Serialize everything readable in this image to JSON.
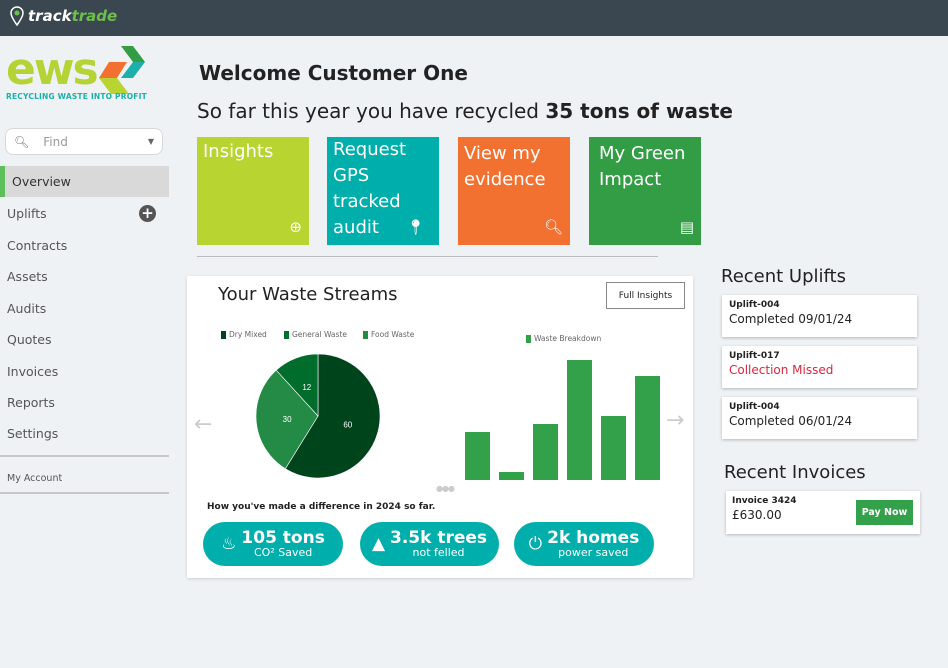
{
  "app": {
    "brand_a": "track",
    "brand_b": "trade"
  },
  "logo": {
    "word": "ews",
    "tagline": "RECYCLING WASTE INTO PROFIT"
  },
  "search": {
    "placeholder": "Find"
  },
  "sidebar": {
    "items": [
      {
        "label": "Overview",
        "active": true
      },
      {
        "label": "Uplifts"
      },
      {
        "label": "Contracts"
      },
      {
        "label": "Assets"
      },
      {
        "label": "Audits"
      },
      {
        "label": "Quotes"
      },
      {
        "label": "Invoices"
      },
      {
        "label": "Reports"
      },
      {
        "label": "Settings"
      }
    ],
    "account": "My Account"
  },
  "header": {
    "welcome": "Welcome Customer One",
    "recycled_prefix": "So far this year you have recycled ",
    "recycled_amount": "35 tons of waste"
  },
  "tiles": [
    {
      "label": "Insights",
      "color": "#b8d430",
      "icon": "plus-circle-icon"
    },
    {
      "label": "Request GPS tracked audit",
      "color": "#00aeab",
      "icon": "map-pin-icon"
    },
    {
      "label": "View my evidence",
      "color": "#f37130",
      "icon": "search-icon"
    },
    {
      "label": "My Green Impact",
      "color": "#339d46",
      "icon": "receipt-icon"
    }
  ],
  "waste": {
    "title": "Your Waste Streams",
    "full_insights": "Full Insights",
    "difference": "How you've made a difference in 2024 so far.",
    "stats": [
      {
        "value": "105 tons",
        "label": "CO² Saved",
        "icon": "flame-icon"
      },
      {
        "value": "3.5k trees",
        "label": "not felled",
        "icon": "tree-icon"
      },
      {
        "value": "2k homes",
        "label": "power saved",
        "icon": "power-icon"
      }
    ]
  },
  "chart_data": [
    {
      "type": "pie",
      "legend": [
        "Dry Mixed",
        "General Waste",
        "Food Waste"
      ],
      "slices": [
        {
          "name": "Dry Mixed",
          "value": 60,
          "color": "#00441b"
        },
        {
          "name": "Food Waste",
          "value": 30,
          "color": "#238b45"
        },
        {
          "name": "General Waste",
          "value": 12,
          "color": "#006d2c"
        }
      ],
      "legend_placement": "top"
    },
    {
      "type": "bar",
      "series": [
        {
          "name": "Waste Breakdown",
          "values": [
            6,
            1,
            7,
            15,
            8,
            13
          ]
        }
      ],
      "color": "#33a04a",
      "legend_placement": "top"
    }
  ],
  "recent_uplifts": {
    "title": "Recent Uplifts",
    "items": [
      {
        "id": "Uplift-004",
        "status": "Completed 09/01/24",
        "color": "#222222"
      },
      {
        "id": "Uplift-017",
        "status": "Collection Missed",
        "color": "#d9263c"
      },
      {
        "id": "Uplift-004",
        "status": "Completed 06/01/24",
        "color": "#222222"
      }
    ]
  },
  "recent_invoices": {
    "title": "Recent Invoices",
    "items": [
      {
        "id": "Invoice 3424",
        "amount": "£630.00",
        "action": "Pay Now"
      }
    ]
  }
}
